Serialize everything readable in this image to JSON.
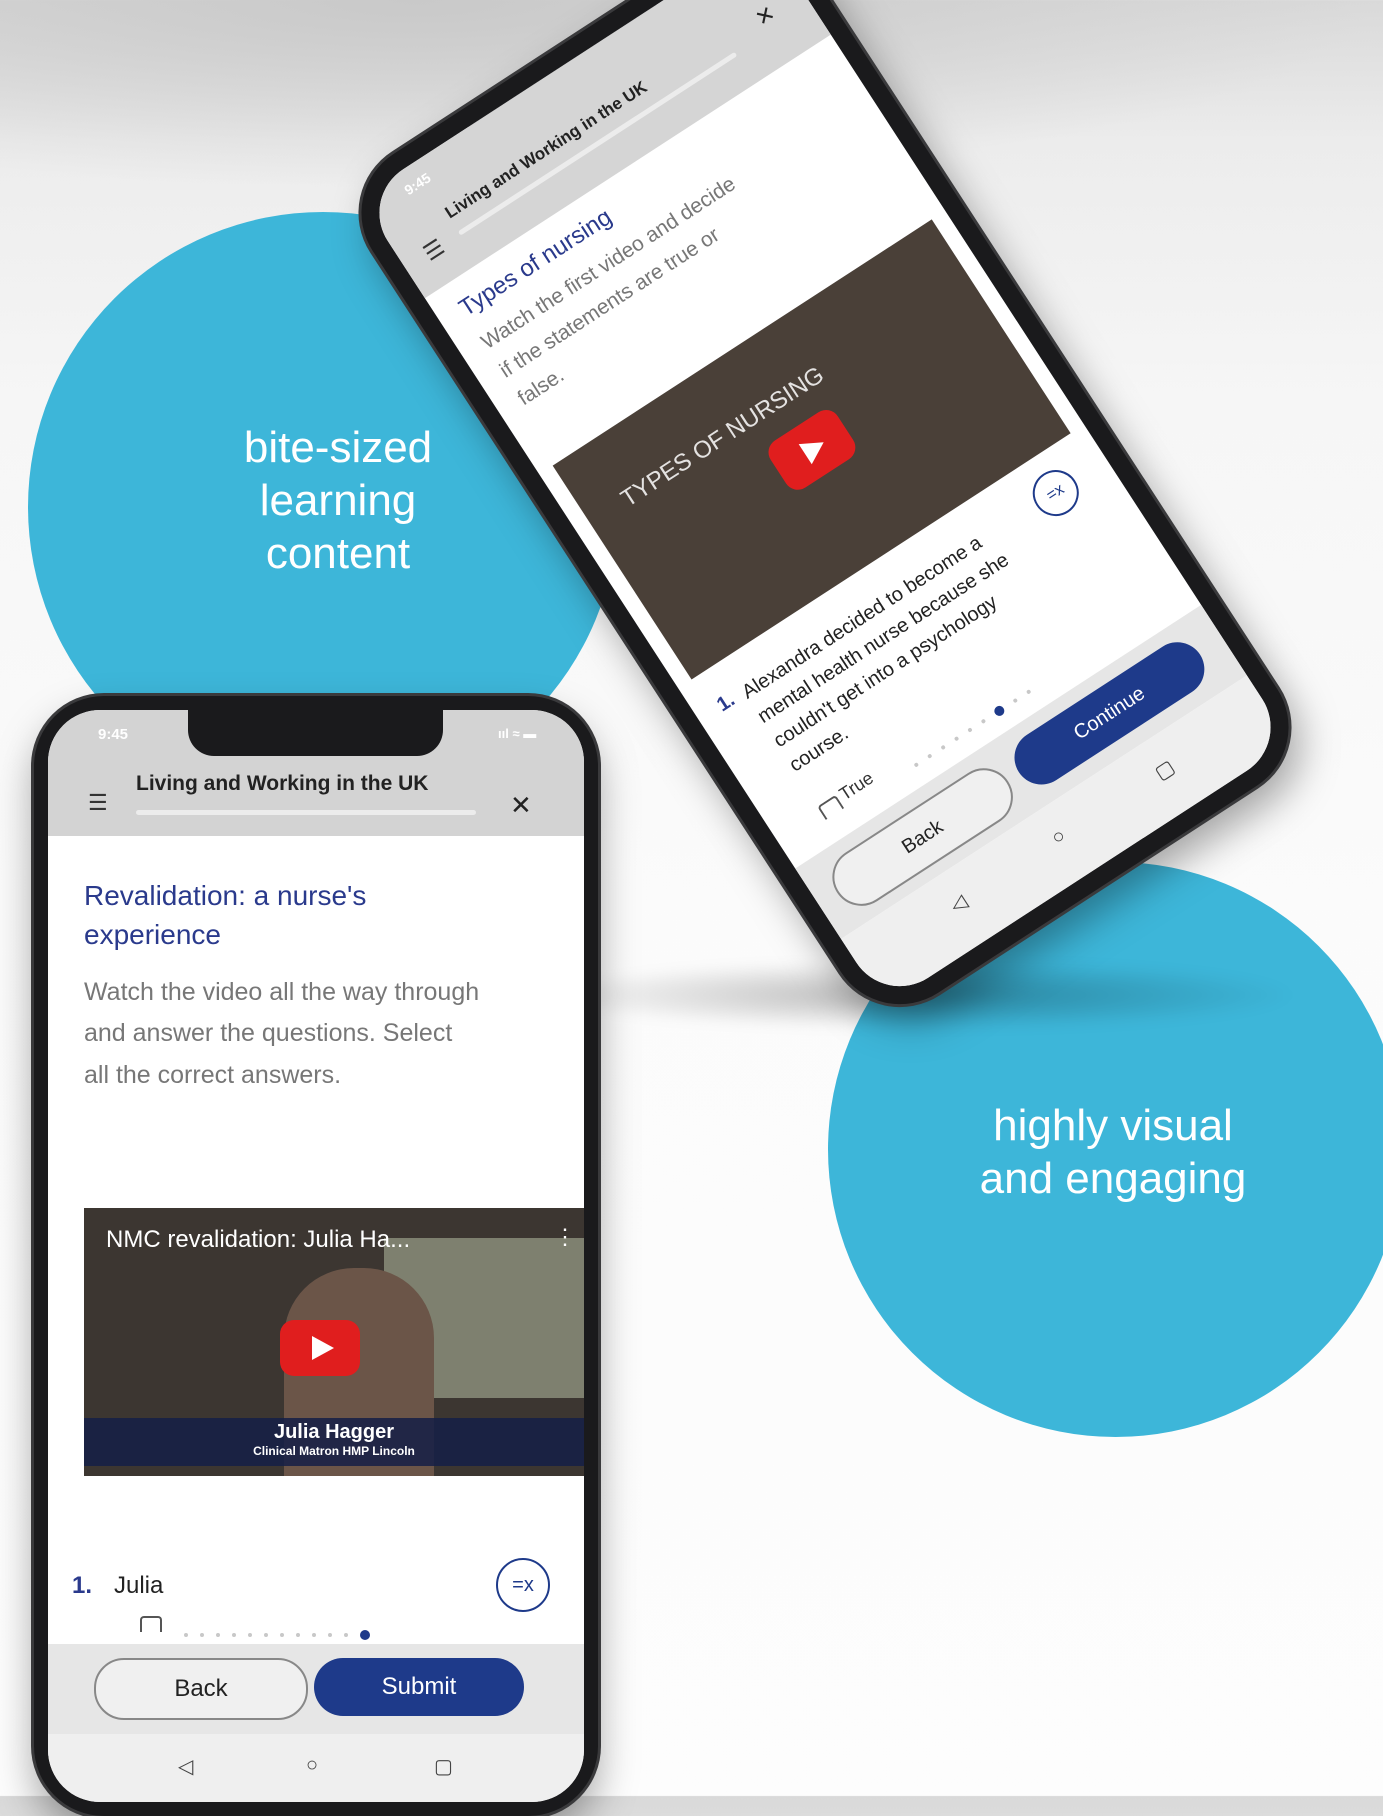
{
  "callouts": {
    "bite_sized": "bite-sized learning content",
    "bite_sized_lines": [
      "bite-sized",
      "learning",
      "content"
    ],
    "visual_lines": [
      "highly visual",
      "and engaging"
    ]
  },
  "colors": {
    "circle": "#3db6d9",
    "primary_button": "#1e3a8a",
    "title_text": "#2a3a8c"
  },
  "phone_front": {
    "status_time": "9:45",
    "status_icons": "ııl ≈ ▬",
    "menu_icon": "menu-icon",
    "app_title": "Living and Working in the UK",
    "close_label": "✕",
    "lesson_title": "Revalidation: a nurse's experience",
    "lesson_desc": "Watch the video all the way through and answer the questions. Select all the correct answers.",
    "video_title": "NMC revalidation: Julia Ha...",
    "video_menu": "⋮",
    "video_caption_name": "Julia Hagger",
    "video_caption_role": "Clinical Matron HMP Lincoln",
    "question_number": "1.",
    "question_text": "Julia",
    "tool_label": "=x",
    "back_label": "Back",
    "submit_label": "Submit",
    "nav_back": "◁",
    "nav_home": "○",
    "nav_recent": "▢"
  },
  "phone_back": {
    "status_time": "9:45",
    "app_title": "Living and Working in the UK",
    "close_label": "✕",
    "lesson_title": "Types of nursing",
    "lesson_desc": "Watch the first video and decide if the statements are true or false.",
    "video_overlay": "TYPES OF NURSING",
    "question_number": "1.",
    "question_text": "Alexandra decided to become a mental health nurse because she couldn't get into a psychology course.",
    "option_true": "True",
    "tool_label": "=x",
    "back_label": "Back",
    "continue_label": "Continue",
    "nav_back": "◁",
    "nav_home": "○",
    "nav_recent": "▢"
  }
}
